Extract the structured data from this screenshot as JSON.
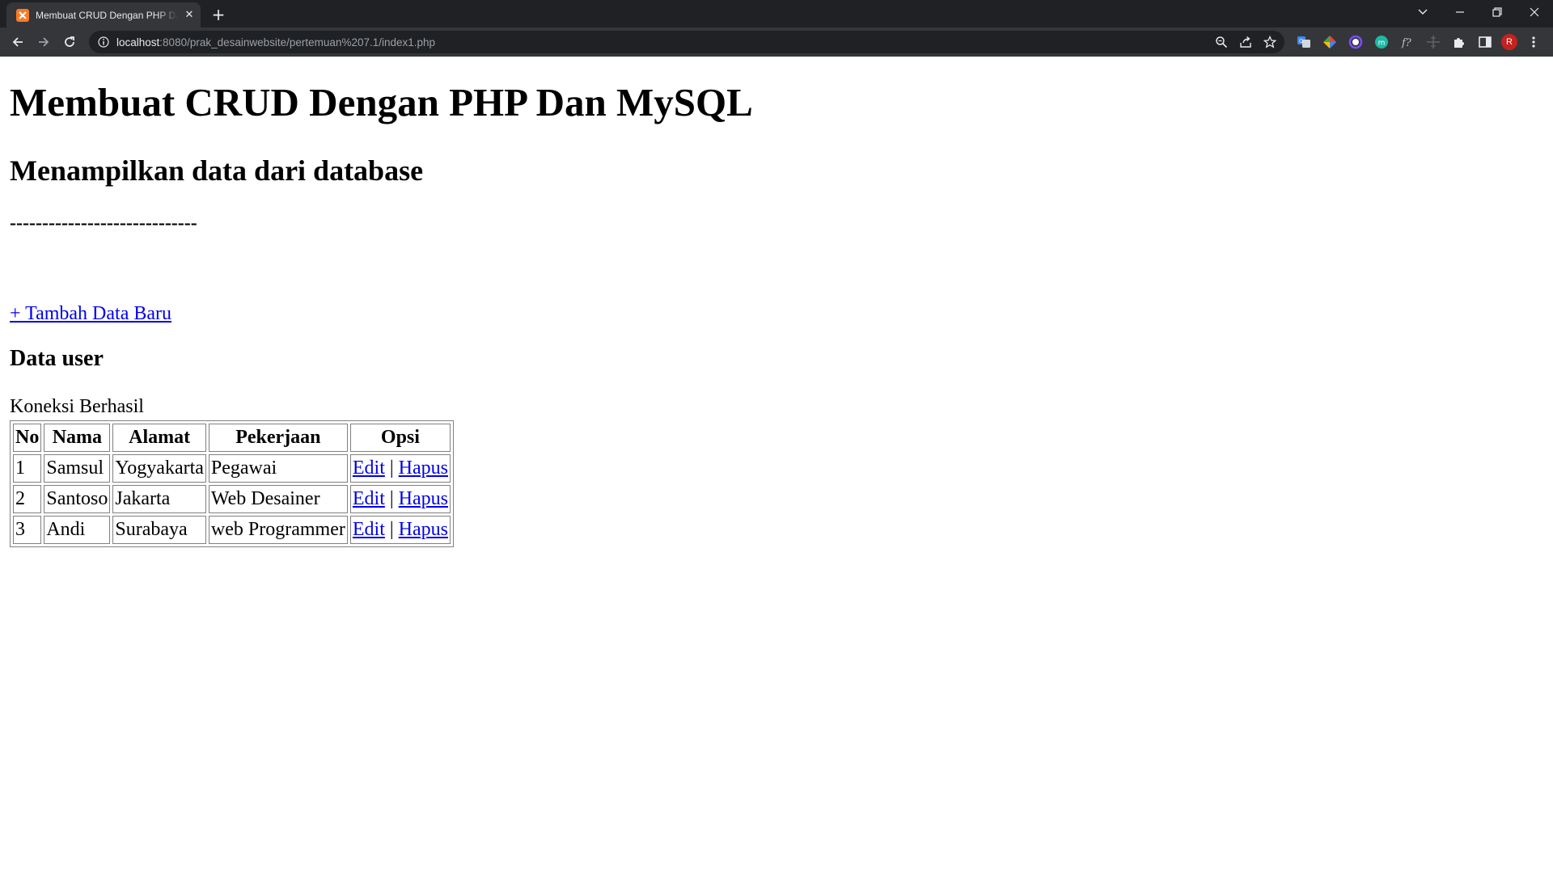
{
  "browser": {
    "tab_title": "Membuat CRUD Dengan PHP Dan MySQL",
    "url_host": "localhost",
    "url_rest": ":8080/prak_desainwebsite/pertemuan%207.1/index1.php",
    "profile_initial": "R"
  },
  "page": {
    "title": "Membuat CRUD Dengan PHP Dan MySQL",
    "subtitle": "Menampilkan data dari database",
    "separator": "-----------------------------",
    "add_link": "+ Tambah Data Baru",
    "section_title": "Data user",
    "status": "Koneksi Berhasil"
  },
  "table": {
    "headers": [
      "No",
      "Nama",
      "Alamat",
      "Pekerjaan",
      "Opsi"
    ],
    "rows": [
      {
        "no": "1",
        "nama": "Samsul",
        "alamat": "Yogyakarta",
        "pekerjaan": "Pegawai",
        "edit": "Edit",
        "sep": "|",
        "hapus": "Hapus"
      },
      {
        "no": "2",
        "nama": "Santoso",
        "alamat": "Jakarta",
        "pekerjaan": "Web Desainer",
        "edit": "Edit",
        "sep": "|",
        "hapus": "Hapus"
      },
      {
        "no": "3",
        "nama": "Andi",
        "alamat": "Surabaya",
        "pekerjaan": "web Programmer",
        "edit": "Edit",
        "sep": "|",
        "hapus": "Hapus"
      }
    ]
  },
  "icons": [
    "xampp-favicon",
    "close-icon",
    "plus-icon",
    "chevron-down-icon",
    "minimize-icon",
    "restore-icon",
    "window-close-icon",
    "back-arrow-icon",
    "forward-arrow-icon",
    "reload-icon",
    "info-icon",
    "zoom-icon",
    "share-icon",
    "star-icon",
    "translate-extension-icon",
    "color-extension-icon",
    "circle-extension-icon",
    "m-extension-icon",
    "formula-extension-icon",
    "ruler-extension-icon",
    "puzzle-icon",
    "side-panel-icon",
    "kebab-menu-icon"
  ]
}
